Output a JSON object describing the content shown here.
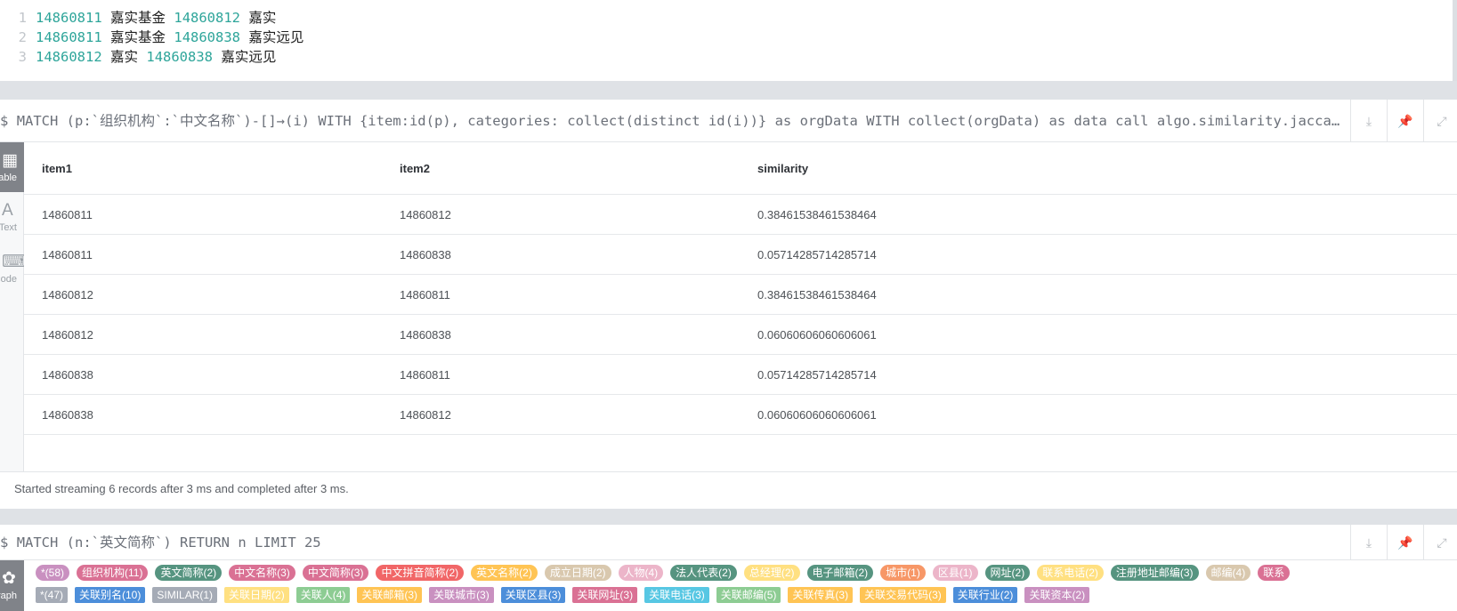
{
  "top_output": {
    "lines": [
      {
        "n": "1",
        "id1": "14860811",
        "name1": "嘉实基金",
        "id2": "14860812",
        "name2": "嘉实"
      },
      {
        "n": "2",
        "id1": "14860811",
        "name1": "嘉实基金",
        "id2": "14860838",
        "name2": "嘉实远见"
      },
      {
        "n": "3",
        "id1": "14860812",
        "name1": "嘉实",
        "id2": "14860838",
        "name2": "嘉实远见"
      }
    ]
  },
  "frame1": {
    "prompt": "$",
    "query": "MATCH (p:`组织机构`:`中文名称`)-[]→(i) WITH {item:id(p), categories: collect(distinct id(i))} as orgData WITH collect(orgData) as data call algo.similarity.jaccard",
    "sidebar": [
      {
        "icon": "▦",
        "label": "Table"
      },
      {
        "icon": "A",
        "label": "Text"
      },
      {
        "icon": "⌨",
        "label": "Code"
      }
    ],
    "table": {
      "headers": [
        "item1",
        "item2",
        "similarity"
      ],
      "rows": [
        [
          "14860811",
          "14860812",
          "0.38461538461538464"
        ],
        [
          "14860811",
          "14860838",
          "0.05714285714285714"
        ],
        [
          "14860812",
          "14860811",
          "0.38461538461538464"
        ],
        [
          "14860812",
          "14860838",
          "0.06060606060606061"
        ],
        [
          "14860838",
          "14860811",
          "0.05714285714285714"
        ],
        [
          "14860838",
          "14860812",
          "0.06060606060606061"
        ]
      ]
    },
    "status": "Started streaming 6 records after 3 ms and completed after 3 ms."
  },
  "frame2": {
    "prompt": "$",
    "query": "MATCH (n:`英文简称`) RETURN n LIMIT 25",
    "sidebar": [
      {
        "icon": "✿",
        "label": "Graph"
      }
    ],
    "node_labels": [
      {
        "text": "*(58)",
        "color": "#c990c0"
      },
      {
        "text": "组织机构(11)",
        "color": "#da7194"
      },
      {
        "text": "英文简称(2)",
        "color": "#569480"
      },
      {
        "text": "中文名称(3)",
        "color": "#da7194"
      },
      {
        "text": "中文简称(3)",
        "color": "#da7194"
      },
      {
        "text": "中文拼音简称(2)",
        "color": "#f16667"
      },
      {
        "text": "英文名称(2)",
        "color": "#ffc454"
      },
      {
        "text": "成立日期(2)",
        "color": "#d9c8ae"
      },
      {
        "text": "人物(4)",
        "color": "#ecb5c9"
      },
      {
        "text": "法人代表(2)",
        "color": "#569480"
      },
      {
        "text": "总经理(2)",
        "color": "#ffe081"
      },
      {
        "text": "电子邮箱(2)",
        "color": "#569480"
      },
      {
        "text": "城市(1)",
        "color": "#f79767"
      },
      {
        "text": "区县(1)",
        "color": "#ecb5c9"
      },
      {
        "text": "网址(2)",
        "color": "#569480"
      },
      {
        "text": "联系电话(2)",
        "color": "#ffe081"
      },
      {
        "text": "注册地址邮编(3)",
        "color": "#569480"
      },
      {
        "text": "邮编(4)",
        "color": "#d9c8ae"
      },
      {
        "text": "联系",
        "color": "#da7194"
      }
    ],
    "rel_types": [
      {
        "text": "*(47)",
        "color": "#a5abb6"
      },
      {
        "text": "关联别名(10)",
        "color": "#4c8eda"
      },
      {
        "text": "SIMILAR(1)",
        "color": "#a5abb6"
      },
      {
        "text": "关联日期(2)",
        "color": "#ffe081"
      },
      {
        "text": "关联人(4)",
        "color": "#8dcc93"
      },
      {
        "text": "关联邮箱(3)",
        "color": "#ffc454"
      },
      {
        "text": "关联城市(3)",
        "color": "#c990c0"
      },
      {
        "text": "关联区县(3)",
        "color": "#4c8eda"
      },
      {
        "text": "关联网址(3)",
        "color": "#da7194"
      },
      {
        "text": "关联电话(3)",
        "color": "#57c7e3"
      },
      {
        "text": "关联邮编(5)",
        "color": "#8dcc93"
      },
      {
        "text": "关联传真(3)",
        "color": "#ffc454"
      },
      {
        "text": "关联交易代码(3)",
        "color": "#ffc454"
      },
      {
        "text": "关联行业(2)",
        "color": "#4c8eda"
      },
      {
        "text": "关联资本(2)",
        "color": "#c990c0"
      }
    ]
  },
  "icons": {
    "download": "download-icon",
    "pin": "pin-icon",
    "expand": "expand-icon"
  }
}
